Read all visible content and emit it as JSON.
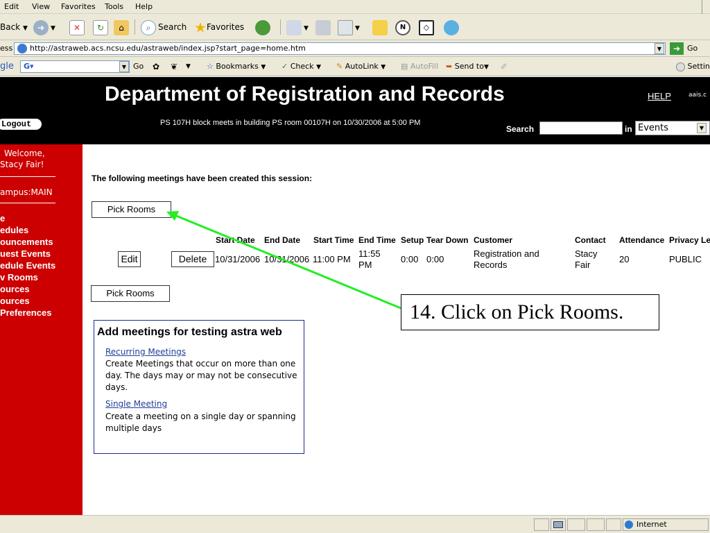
{
  "browser": {
    "menu": [
      "Edit",
      "View",
      "Favorites",
      "Tools",
      "Help"
    ],
    "toolbar": {
      "back": "Back",
      "search": "Search",
      "favorites": "Favorites"
    },
    "address": {
      "label": "ess",
      "url": "http://astraweb.acs.ncsu.edu/astraweb/index.jsp?start_page=home.htm",
      "go": "Go"
    },
    "google": {
      "label": "gle",
      "go": "Go",
      "bookmarks": "Bookmarks",
      "check": "Check",
      "autolink": "AutoLink",
      "autofill": "AutoFill",
      "sendto": "Send to",
      "settings": "Settin"
    },
    "status": {
      "zone": "Internet"
    }
  },
  "header": {
    "title": "Department of Registration and Records",
    "help": "HELP",
    "user_code": "aais.c",
    "logout": "Logout",
    "notice": "PS 107H block meets in building PS room 00107H on  10/30/2006 at 5:00 PM",
    "search_label": "Search",
    "search_value": "",
    "in_label": "in",
    "scope": "Events"
  },
  "sidebar": {
    "welcome": "Welcome,",
    "user": "Stacy Fair!",
    "campus": "ampus:MAIN",
    "nav": [
      "e",
      "edules",
      "ouncements",
      "uest Events",
      "edule Events",
      "v Rooms",
      "ources",
      "ources",
      "Preferences"
    ]
  },
  "content": {
    "session_heading": "The following meetings have been created this session:",
    "pick_rooms": "Pick Rooms",
    "columns": [
      "Start Date",
      "End Date",
      "Start Time",
      "End Time",
      "Setup",
      "Tear Down",
      "Customer",
      "Contact",
      "Attendance",
      "Privacy Le"
    ],
    "row": {
      "edit": "Edit",
      "delete": "Delete",
      "start_date": "10/31/2006",
      "end_date": "10/31/2006",
      "start_time": "11:00 PM",
      "end_time": "11:55 PM",
      "setup": "0:00",
      "tear_down": "0:00",
      "customer": "Registration and Records",
      "contact": "Stacy Fair",
      "attendance": "20",
      "privacy": "PUBLIC"
    },
    "add_box": {
      "title": "Add meetings for testing astra web",
      "recurring_link": "Recurring Meetings",
      "recurring_desc": "Create Meetings that occur on more than one day. The days may or may not be consecutive days.",
      "single_link": "Single Meeting",
      "single_desc": "Create a meeting on a single day or spanning multiple days"
    }
  },
  "callout": {
    "text": "14. Click on Pick Rooms.",
    "color": "#22ee22"
  },
  "colors": {
    "sidebar": "#cc0000",
    "header": "#000000",
    "link": "#1f3f99"
  }
}
